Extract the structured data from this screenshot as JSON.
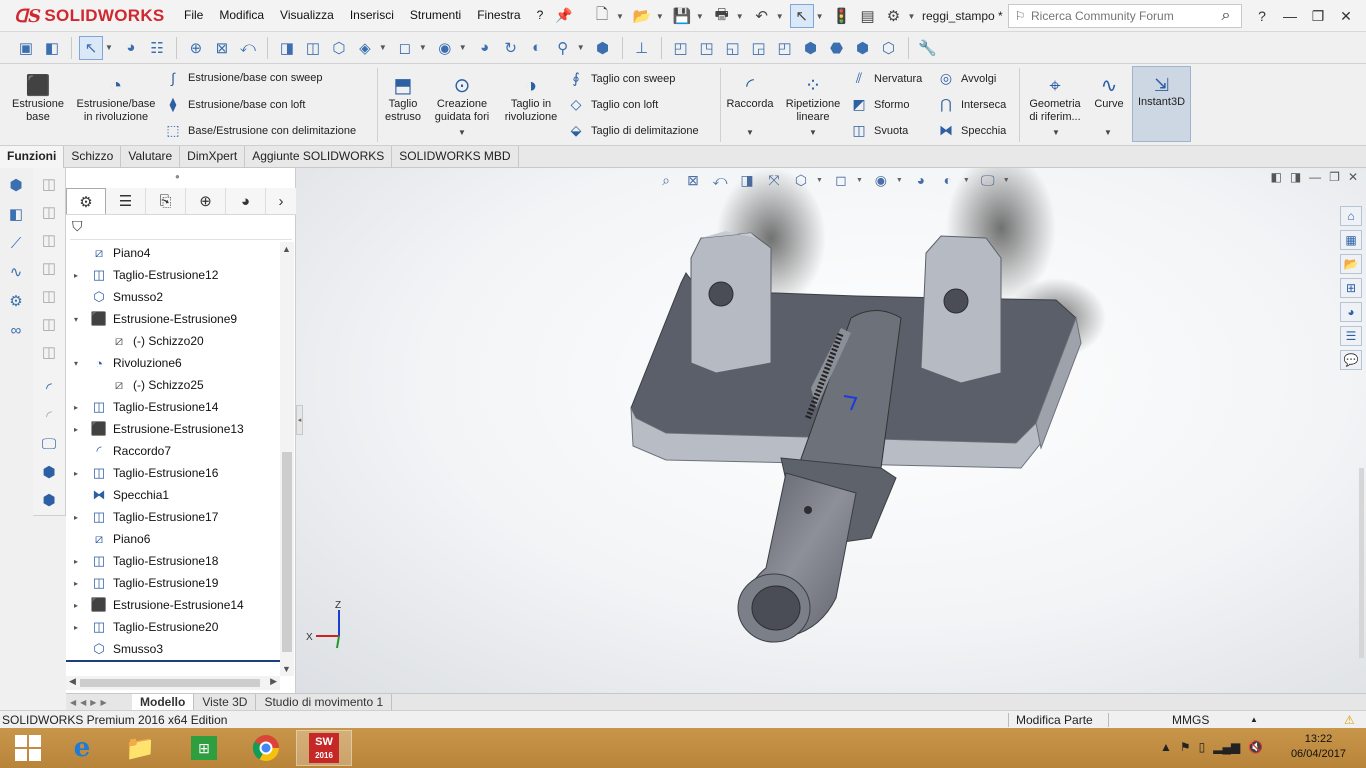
{
  "app": {
    "logo_text": "SOLIDWORKS",
    "document_name": "reggi_stampo *",
    "colors": {
      "brand": "#d1282f",
      "accent": "#2d5fa3",
      "selection": "#dbe8f7"
    }
  },
  "menu": [
    "File",
    "Modifica",
    "Visualizza",
    "Inserisci",
    "Strumenti",
    "Finestra",
    "?"
  ],
  "search": {
    "placeholder": "Ricerca Community Forum"
  },
  "ribbon": {
    "estrusione_base": "Estrusione\nbase",
    "estrusione_rivoluzione": "Estrusione/base\nin rivoluzione",
    "sweep": "Estrusione/base con sweep",
    "loft": "Estrusione/base con loft",
    "delimitazione": "Base/Estrusione con delimitazione",
    "taglio_estruso": "Taglio\nestruso",
    "creazione_fori": "Creazione\nguidata fori",
    "taglio_rivoluzione": "Taglio in\nrivoluzione",
    "taglio_sweep": "Taglio con sweep",
    "taglio_loft": "Taglio con loft",
    "taglio_delimitazione": "Taglio di delimitazione",
    "raccorda": "Raccorda",
    "ripetizione": "Ripetizione\nlineare",
    "nervatura": "Nervatura",
    "sformo": "Sformo",
    "svuota": "Svuota",
    "avvolgi": "Avvolgi",
    "interseca": "Interseca",
    "specchia": "Specchia",
    "geometria": "Geometria\ndi riferim...",
    "curve": "Curve",
    "instant3d": "Instant3D"
  },
  "tabs": [
    "Funzioni",
    "Schizzo",
    "Valutare",
    "DimXpert",
    "Aggiunte SOLIDWORKS",
    "SOLIDWORKS MBD"
  ],
  "tree": [
    {
      "label": "Piano4",
      "icon": "plane-icon",
      "expand": "",
      "child": false
    },
    {
      "label": "Taglio-Estrusione12",
      "icon": "cut-extrude-icon",
      "expand": "▸",
      "child": false
    },
    {
      "label": "Smusso2",
      "icon": "chamfer-icon",
      "expand": "",
      "child": false
    },
    {
      "label": "Estrusione-Estrusione9",
      "icon": "boss-extrude-icon",
      "expand": "▾",
      "child": false
    },
    {
      "label": "(-) Schizzo20",
      "icon": "sketch-icon",
      "expand": "",
      "child": true
    },
    {
      "label": "Rivoluzione6",
      "icon": "revolve-icon",
      "expand": "▾",
      "child": false
    },
    {
      "label": "(-) Schizzo25",
      "icon": "sketch-icon",
      "expand": "",
      "child": true
    },
    {
      "label": "Taglio-Estrusione14",
      "icon": "cut-extrude-icon",
      "expand": "▸",
      "child": false
    },
    {
      "label": "Estrusione-Estrusione13",
      "icon": "boss-extrude-icon",
      "expand": "▸",
      "child": false
    },
    {
      "label": "Raccordo7",
      "icon": "fillet-icon",
      "expand": "",
      "child": false
    },
    {
      "label": "Taglio-Estrusione16",
      "icon": "cut-extrude-icon",
      "expand": "▸",
      "child": false
    },
    {
      "label": "Specchia1",
      "icon": "mirror-icon",
      "expand": "",
      "child": false
    },
    {
      "label": "Taglio-Estrusione17",
      "icon": "cut-extrude-icon",
      "expand": "▸",
      "child": false
    },
    {
      "label": "Piano6",
      "icon": "plane-icon",
      "expand": "",
      "child": false
    },
    {
      "label": "Taglio-Estrusione18",
      "icon": "cut-extrude-icon",
      "expand": "▸",
      "child": false
    },
    {
      "label": "Taglio-Estrusione19",
      "icon": "cut-extrude-icon",
      "expand": "▸",
      "child": false
    },
    {
      "label": "Estrusione-Estrusione14",
      "icon": "boss-extrude-icon",
      "expand": "▸",
      "child": false
    },
    {
      "label": "Taglio-Estrusione20",
      "icon": "cut-extrude-icon",
      "expand": "▸",
      "child": false
    },
    {
      "label": "Smusso3",
      "icon": "chamfer-icon",
      "expand": "",
      "child": false
    }
  ],
  "bottom_tabs": [
    "Modello",
    "Viste 3D",
    "Studio di movimento 1"
  ],
  "status": {
    "edition": "SOLIDWORKS Premium 2016 x64 Edition",
    "mode": "Modifica Parte",
    "units": "MMGS"
  },
  "triad": {
    "z": "Z",
    "x": "X"
  },
  "taskbar": {
    "sw_label": "2016",
    "time": "13:22",
    "date": "06/04/2017"
  }
}
